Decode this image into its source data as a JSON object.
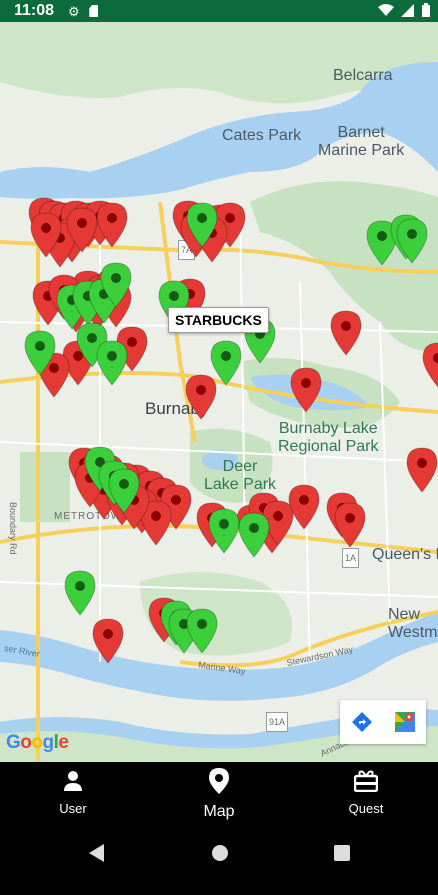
{
  "status_bar": {
    "time": "11:08",
    "left_icons": [
      "gear-icon",
      "sd-card-icon"
    ],
    "right_icons": [
      "wifi-icon",
      "signal-icon",
      "battery-icon"
    ]
  },
  "map": {
    "labels": {
      "belcarra": "Belcarra",
      "cates_park": "Cates Park",
      "barnet_marine_park": "Barnet\nMarine Park",
      "burnaby": "Burnaby",
      "burnaby_lake": "Burnaby Lake\nRegional Park",
      "deer_lake": "Deer\nLake Park",
      "metrotown": "METROTOWN",
      "queens_park": "Queen's P",
      "new_westminster": "New\nWestminste",
      "boundary_rd": "Boundary Rd",
      "marine_way": "Marine Way",
      "stewardson_way": "Stewardson Way",
      "annacis_channel": "Annacis Chann",
      "fraser_river": "ser River",
      "hwy_7a": "7A",
      "hwy_1a": "1A",
      "hwy_91a": "91A"
    },
    "tooltip": "STARBUCKS",
    "marker_colors": {
      "red": "#e53935",
      "green": "#3ccf3c"
    },
    "red_marker_count": 57,
    "green_marker_count": 23,
    "attribution": "Google",
    "directions_button_icon": "directions-icon",
    "open_in_maps_icon": "google-maps-icon"
  },
  "bottom_nav": {
    "items": [
      {
        "label": "User",
        "icon": "user-icon"
      },
      {
        "label": "Map",
        "icon": "map-pin-icon"
      },
      {
        "label": "Quest",
        "icon": "quest-icon"
      }
    ],
    "active": "Map"
  },
  "system_nav": [
    "back-icon",
    "home-icon",
    "recents-icon"
  ]
}
